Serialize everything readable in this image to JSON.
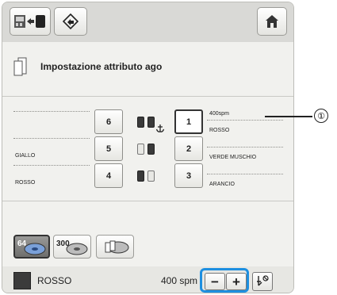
{
  "header": {
    "title": "Impostazione attributo ago"
  },
  "needles": {
    "left": [
      {
        "number": "6",
        "color": ""
      },
      {
        "number": "5",
        "color": "GIALLO"
      },
      {
        "number": "4",
        "color": "ROSSO"
      }
    ],
    "right": [
      {
        "number": "1",
        "speed": "400spm",
        "color": "ROSSO",
        "selected": true
      },
      {
        "number": "2",
        "speed": "",
        "color": "VERDE MUSCHIO",
        "selected": false
      },
      {
        "number": "3",
        "speed": "",
        "color": "ARANCIO",
        "selected": false
      }
    ]
  },
  "settings_buttons": {
    "speed_64_label": "64",
    "speed_300_label": "300"
  },
  "bottom_bar": {
    "current_color": "ROSSO",
    "current_color_swatch": "#3b3b3b",
    "speed": "400 spm",
    "minus_label": "−",
    "plus_label": "+"
  },
  "callout": {
    "number": "①"
  },
  "colors": {
    "highlight": "#1e8fe0"
  }
}
